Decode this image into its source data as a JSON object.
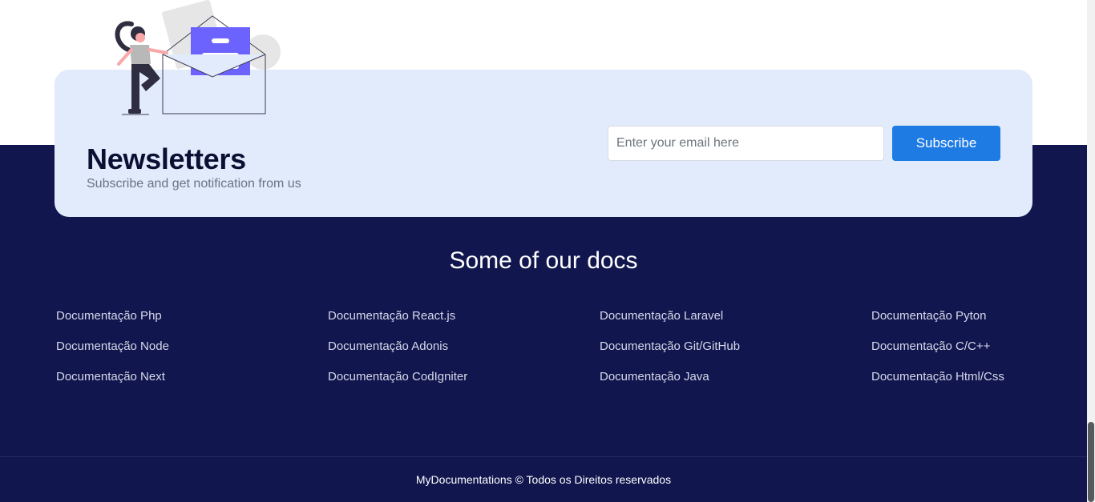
{
  "newsletter": {
    "title": "Newsletters",
    "subtitle": "Subscribe and get notification from us",
    "email_placeholder": "Enter your email here",
    "subscribe_label": "Subscribe"
  },
  "docs": {
    "heading": "Some of our docs",
    "columns": [
      [
        "Documentação Php",
        "Documentação Node",
        "Documentação Next"
      ],
      [
        "Documentação React.js",
        "Documentação Adonis",
        "Documentação CodIgniter"
      ],
      [
        "Documentação Laravel",
        "Documentação Git/GitHub",
        "Documentação Java"
      ],
      [
        "Documentação Pyton",
        "Documentação C/C++",
        "Documentação Html/Css"
      ]
    ]
  },
  "footer": {
    "copyright": "MyDocumentations © Todos os Direitos reservados"
  },
  "colors": {
    "footer_bg": "#11164e",
    "card_bg": "#e1ebfb",
    "accent": "#1e7be4",
    "illustration_accent": "#6c63ff"
  }
}
